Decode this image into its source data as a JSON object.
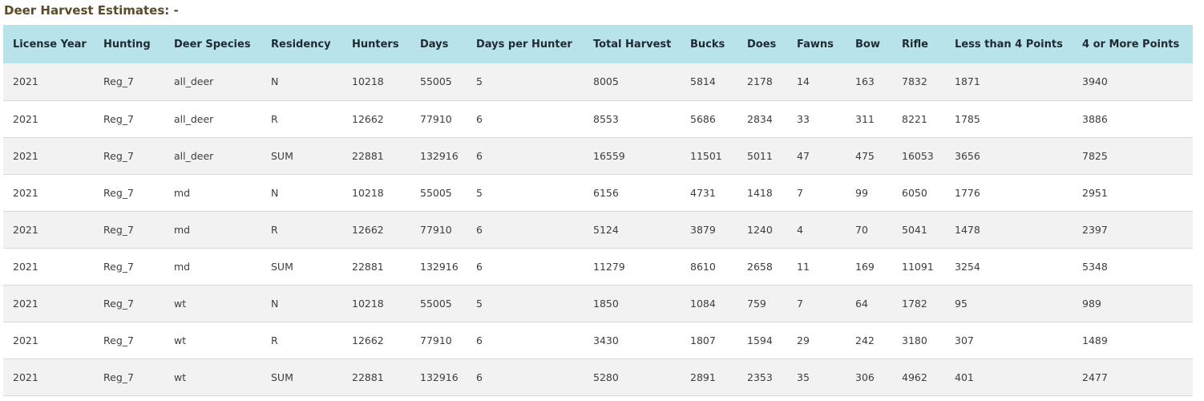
{
  "title": "Deer Harvest Estimates: -",
  "table": {
    "columns": [
      "License Year",
      "Hunting",
      "Deer Species",
      "Residency",
      "Hunters",
      "Days",
      "Days per Hunter",
      "Total Harvest",
      "Bucks",
      "Does",
      "Fawns",
      "Bow",
      "Rifle",
      "Less than 4 Points",
      "4 or More Points"
    ],
    "rows": [
      [
        "2021",
        "Reg_7",
        "all_deer",
        "N",
        "10218",
        "55005",
        "5",
        "8005",
        "5814",
        "2178",
        "14",
        "163",
        "7832",
        "1871",
        "3940"
      ],
      [
        "2021",
        "Reg_7",
        "all_deer",
        "R",
        "12662",
        "77910",
        "6",
        "8553",
        "5686",
        "2834",
        "33",
        "311",
        "8221",
        "1785",
        "3886"
      ],
      [
        "2021",
        "Reg_7",
        "all_deer",
        "SUM",
        "22881",
        "132916",
        "6",
        "16559",
        "11501",
        "5011",
        "47",
        "475",
        "16053",
        "3656",
        "7825"
      ],
      [
        "2021",
        "Reg_7",
        "md",
        "N",
        "10218",
        "55005",
        "5",
        "6156",
        "4731",
        "1418",
        "7",
        "99",
        "6050",
        "1776",
        "2951"
      ],
      [
        "2021",
        "Reg_7",
        "md",
        "R",
        "12662",
        "77910",
        "6",
        "5124",
        "3879",
        "1240",
        "4",
        "70",
        "5041",
        "1478",
        "2397"
      ],
      [
        "2021",
        "Reg_7",
        "md",
        "SUM",
        "22881",
        "132916",
        "6",
        "11279",
        "8610",
        "2658",
        "11",
        "169",
        "11091",
        "3254",
        "5348"
      ],
      [
        "2021",
        "Reg_7",
        "wt",
        "N",
        "10218",
        "55005",
        "5",
        "1850",
        "1084",
        "759",
        "7",
        "64",
        "1782",
        "95",
        "989"
      ],
      [
        "2021",
        "Reg_7",
        "wt",
        "R",
        "12662",
        "77910",
        "6",
        "3430",
        "1807",
        "1594",
        "29",
        "242",
        "3180",
        "307",
        "1489"
      ],
      [
        "2021",
        "Reg_7",
        "wt",
        "SUM",
        "22881",
        "132916",
        "6",
        "5280",
        "2891",
        "2353",
        "35",
        "306",
        "4962",
        "401",
        "2477"
      ]
    ]
  },
  "colors": {
    "header_background": "#b9e3ea",
    "title_text": "#5b4a25",
    "row_stripe": "#f2f2f2"
  }
}
